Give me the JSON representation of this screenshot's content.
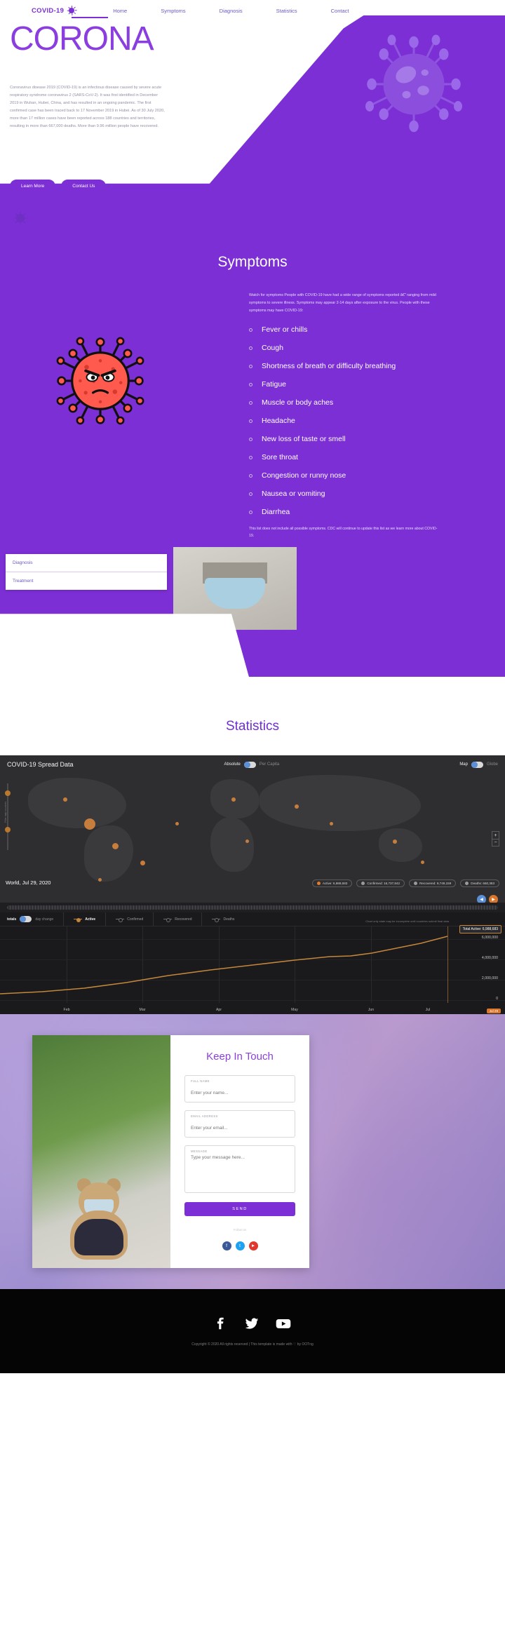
{
  "nav": {
    "brand": "COVID-19",
    "brand_icon": "virus-icon",
    "links": [
      {
        "label": "Home",
        "active": true
      },
      {
        "label": "Symptoms",
        "active": false
      },
      {
        "label": "Diagnosis",
        "active": false
      },
      {
        "label": "Statistics",
        "active": false
      },
      {
        "label": "Contact",
        "active": false
      }
    ]
  },
  "hero": {
    "title": "CORONA",
    "paragraph": "Coronavirus disease 2019 (COVID-19) is an infectious disease caused by severe acute respiratory syndrome coronavirus 2 (SARS-CoV-2). It was first identified in December 2019 in Wuhan, Hubei, China, and has resulted in an ongoing pandemic. The first confirmed case has been traced back to 17 November 2019 in Hubei. As of 30 July 2020, more than 17 million cases have been reported across 188 countries and territories, resulting in more than 667,000 deaths. More than 9.96 million people have recovered.",
    "btn_primary": "Learn More",
    "btn_secondary": "Contact Us"
  },
  "symptoms": {
    "title": "Symptoms",
    "description": "Watch for symptoms People with COVID-19 have had a wide range of symptoms reported â€\" ranging from mild symptoms to severe illness. Symptoms may appear 2-14 days after exposure to the virus. People with these symptoms may have COVID-19:",
    "items": [
      "Fever or chills",
      "Cough",
      "Shortness of breath or difficulty breathing",
      "Fatigue",
      "Muscle or body aches",
      "Headache",
      "New loss of taste or smell",
      "Sore throat",
      "Congestion or runny nose",
      "Nausea or vomiting",
      "Diarrhea"
    ],
    "note": "This list does not include all possible symptoms. CDC will continue to update this list as we learn more about COVID-19."
  },
  "diagnosis": {
    "tabs": [
      {
        "label": "Diagnosis"
      },
      {
        "label": "Treatment"
      }
    ]
  },
  "statistics": {
    "title": "Statistics",
    "map": {
      "heading": "COVID-19 Spread Data",
      "toggle_left": "Absolute",
      "toggle_right": "Per Capita",
      "view_left": "Map",
      "view_right": "Globe",
      "date_label": "World, Jul 29, 2020",
      "slider_text": "Filter map  countries",
      "zoom_in": "+",
      "zoom_out": "−",
      "pills": [
        {
          "label": "Active: 6,988,683",
          "color": "#e07b30"
        },
        {
          "label": "Confirmed: 16,737,842",
          "color": "#9a9a9a"
        },
        {
          "label": "Recovered: 9,749,159",
          "color": "#9a9a9a"
        },
        {
          "label": "Deaths: 660,383",
          "color": "#9a9a9a"
        }
      ]
    },
    "chart_legend": {
      "toggle_left": "totals",
      "toggle_right": "day change",
      "series": [
        {
          "label": "Active",
          "active": true
        },
        {
          "label": "Confirmed",
          "active": false
        },
        {
          "label": "Recovered",
          "active": false
        },
        {
          "label": "Deaths",
          "active": false
        }
      ]
    },
    "chart_note": "Chart only state may be incomplete until countries submit final data",
    "tooltip": "Total Active: 6,988,683",
    "x_badge": "Jul 29"
  },
  "chart_data": {
    "type": "line",
    "title": "Total Active",
    "xlabel": "",
    "ylabel": "",
    "x": [
      "Feb",
      "Mar",
      "Apr",
      "May",
      "Jun",
      "Jul"
    ],
    "ytick_labels": [
      "0",
      "2,000,000",
      "4,000,000",
      "6,000,000"
    ],
    "ylim": [
      0,
      7000000
    ],
    "grid": true,
    "legend_position": "top",
    "series": [
      {
        "name": "Active",
        "color": "#c4863a",
        "x": [
          "Feb",
          "Mar",
          "Apr",
          "May",
          "Jun",
          "Jul"
        ],
        "values": [
          30000,
          180000,
          1300000,
          2400000,
          3900000,
          6988683
        ]
      }
    ],
    "annotations": [
      {
        "text": "Total Active: 6,988,683",
        "x": "Jul 29",
        "y": 6988683
      }
    ]
  },
  "contact": {
    "title": "Keep In Touch",
    "fields": [
      {
        "label": "FULL NAME",
        "placeholder": "Enter your name...",
        "value": "",
        "type": "text"
      },
      {
        "label": "EMAIL ADDRESS",
        "placeholder": "Enter your email...",
        "value": "",
        "type": "email"
      },
      {
        "label": "MESSAGE",
        "placeholder": "Type your message here...",
        "value": "",
        "type": "textarea"
      }
    ],
    "send_label": "SEND",
    "foot_text": "Follow Us",
    "socials": [
      "facebook-icon",
      "twitter-icon",
      "youtube-icon"
    ]
  },
  "footer": {
    "socials": [
      "facebook-icon",
      "twitter-icon",
      "youtube-icon"
    ],
    "copyright": "Copyright © 2020 All rights reserved | This template is made with ♡ by OOTng"
  },
  "colors": {
    "purple": "#7b2fd4",
    "purple_light": "#8b3ee0",
    "dark": "#1a1a1d",
    "orange": "#d9762c"
  }
}
